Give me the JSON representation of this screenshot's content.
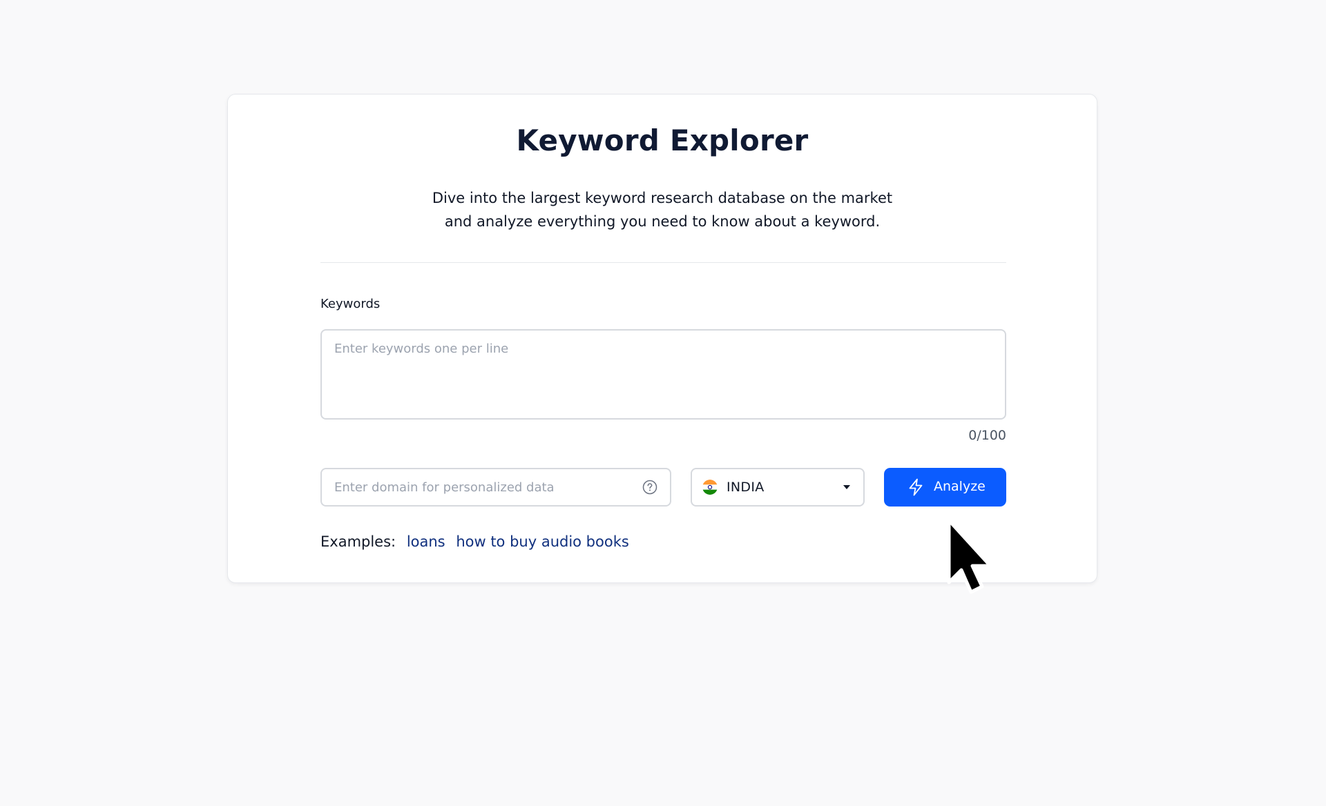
{
  "card": {
    "title": "Keyword Explorer",
    "subtitle_line1": "Dive into the largest keyword research database on the market",
    "subtitle_line2": "and analyze everything you need to know about a keyword."
  },
  "keywords": {
    "label": "Keywords",
    "value": "",
    "placeholder": "Enter keywords one per line",
    "counter": "0/100"
  },
  "domain": {
    "value": "",
    "placeholder": "Enter domain for personalized data",
    "help_icon": "question-circle-icon"
  },
  "country": {
    "selected": "INDIA",
    "flag_icon": "india-flag-icon",
    "caret_icon": "caret-down-icon"
  },
  "analyze": {
    "label": "Analyze",
    "icon": "lightning-bolt-icon",
    "color": "#0b5cff"
  },
  "examples": {
    "label": "Examples:",
    "items": [
      "loans",
      "how to buy audio books"
    ]
  },
  "colors": {
    "background": "#f9f9fa",
    "card": "#ffffff",
    "link": "#10307e",
    "title": "#101a33"
  }
}
